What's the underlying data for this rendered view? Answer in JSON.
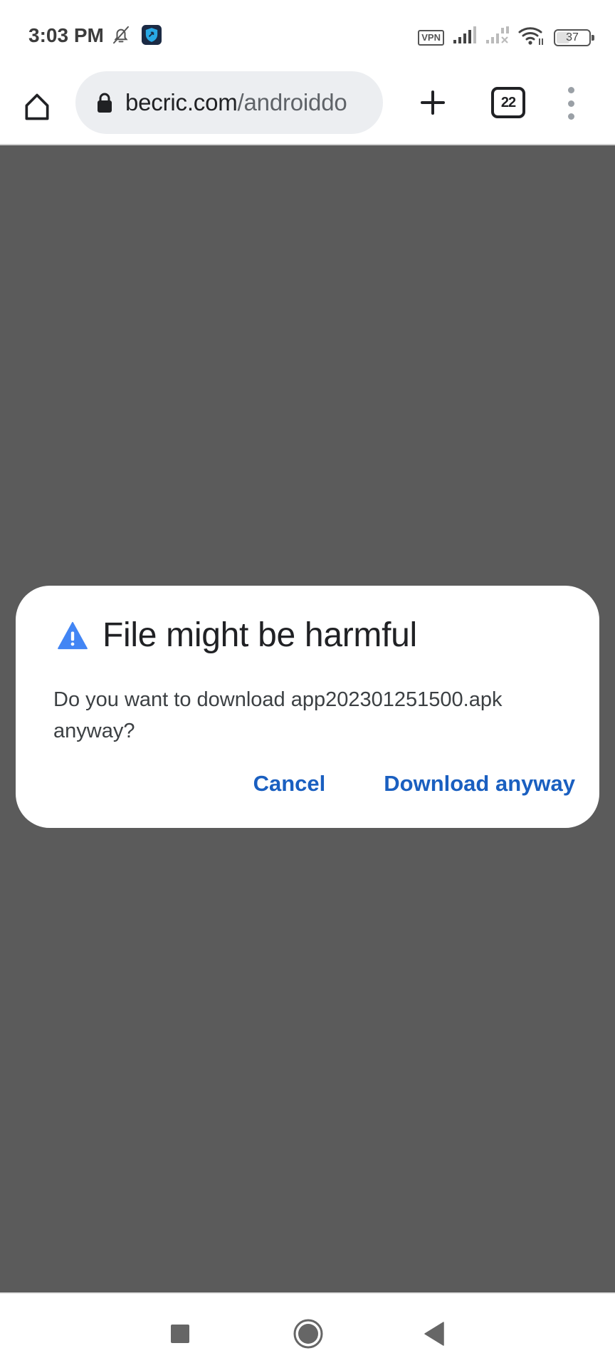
{
  "status_bar": {
    "time": "3:03 PM",
    "left_icons": [
      "bell-off-icon",
      "vpn-shield-app-icon"
    ],
    "vpn_label": "VPN",
    "battery_level": "37",
    "battery_percent": 37
  },
  "browser": {
    "url_domain": "becric.com",
    "url_path": "/androiddo",
    "tab_count": "22",
    "icons": {
      "home": "home-icon",
      "lock": "lock-icon",
      "new_tab": "plus-icon",
      "menu": "more-vert-icon"
    }
  },
  "dialog": {
    "title": "File might be harmful",
    "body": "Do you want to download app202301251500.apk anyway?",
    "cancel_label": "Cancel",
    "confirm_label": "Download anyway",
    "accent_color": "#1a5fc0",
    "warning_color": "#4285f4"
  },
  "nav_bar": {
    "buttons": [
      "recents",
      "home",
      "back"
    ]
  }
}
